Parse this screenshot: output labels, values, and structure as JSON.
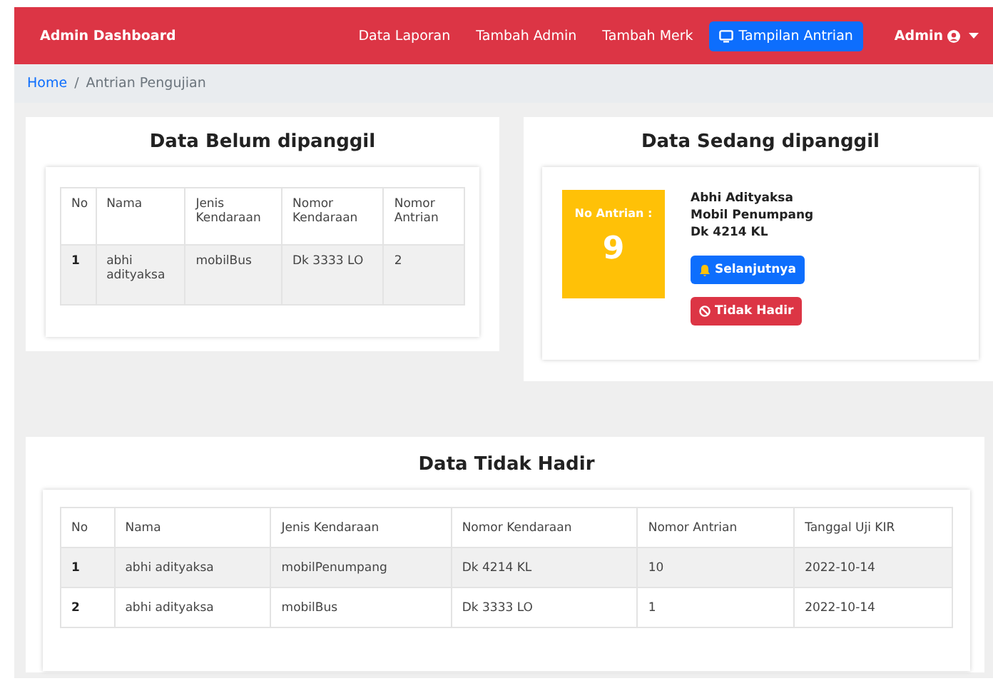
{
  "navbar": {
    "brand": "Admin Dashboard",
    "links": [
      {
        "label": "Data Laporan",
        "selected": false,
        "icon": false
      },
      {
        "label": "Tambah Admin",
        "selected": false,
        "icon": false
      },
      {
        "label": "Tambah Merk",
        "selected": false,
        "icon": false
      },
      {
        "label": "Tampilan Antrian",
        "selected": true,
        "icon": true
      }
    ],
    "user": "Admin"
  },
  "breadcrumb": [
    {
      "label": "Home",
      "kind": "link"
    },
    {
      "label": "/",
      "kind": "separator"
    },
    {
      "label": "Antrian Pengujian",
      "kind": "current"
    }
  ],
  "waiting": {
    "title": "Data Belum dipanggil",
    "columns": [
      "No",
      "Nama",
      "Jenis Kendaraan",
      "Nomor Kendaraan",
      "Nomor Antrian"
    ],
    "rows": [
      [
        "1",
        "abhi adityaksa",
        "mobilBus",
        "Dk 3333 LO",
        "2"
      ]
    ]
  },
  "current": {
    "title": "Data Sedang dipanggil",
    "queue_label": "No Antrian :",
    "queue_number": "9",
    "name": "Abhi Adityaksa",
    "vehicle_type": "Mobil Penumpang",
    "plate": "Dk 4214 KL",
    "buttons": [
      {
        "label": "Selanjutnya",
        "kind": "next"
      },
      {
        "label": "Tidak Hadir",
        "kind": "absent"
      }
    ]
  },
  "absent": {
    "title": "Data Tidak Hadir",
    "columns": [
      "No",
      "Nama",
      "Jenis Kendaraan",
      "Nomor Kendaraan",
      "Nomor Antrian",
      "Tanggal Uji KIR"
    ],
    "rows": [
      [
        "1",
        "abhi adityaksa",
        "mobilPenumpang",
        "Dk 4214 KL",
        "10",
        "2022-10-14"
      ],
      [
        "2",
        "abhi adityaksa",
        "mobilBus",
        "Dk 3333 LO",
        "1",
        "2022-10-14"
      ]
    ]
  }
}
